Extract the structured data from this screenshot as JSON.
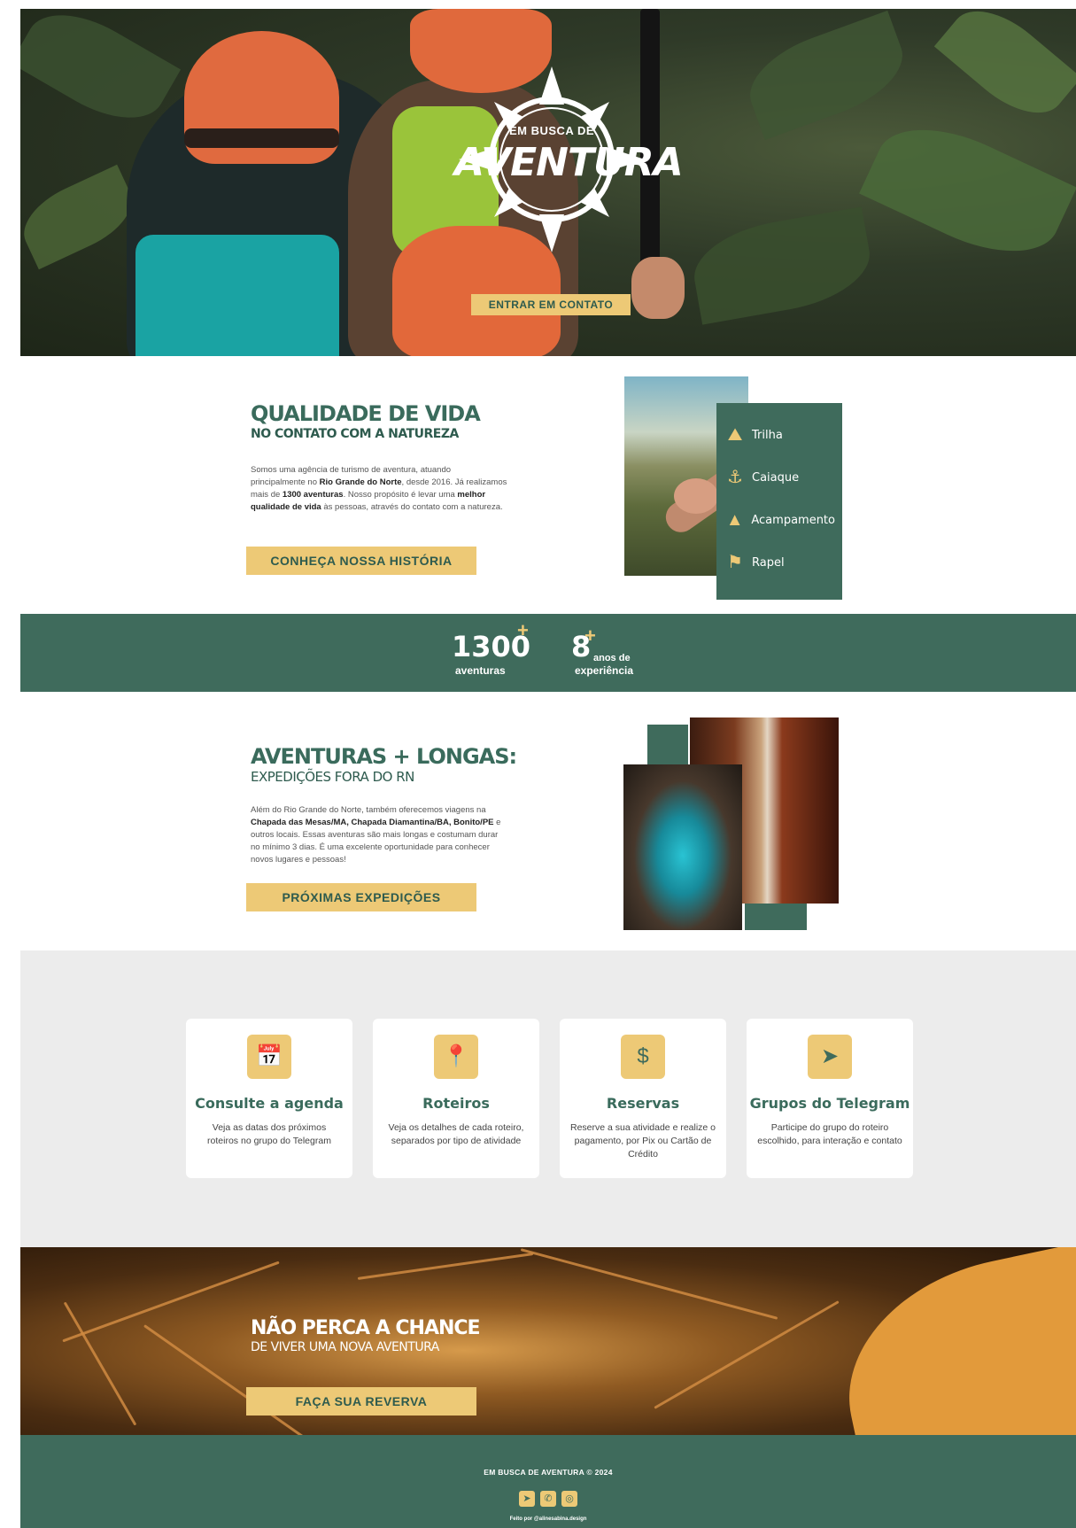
{
  "hero": {
    "logo_small": "EM BUSCA DE",
    "logo_big": "AVENTURA",
    "contact_button": "ENTRAR EM CONTATO"
  },
  "quality": {
    "title": "QUALIDADE DE VIDA",
    "subtitle": "NO CONTATO COM A NATUREZA",
    "paragraph": {
      "p1": "Somos uma agência de turismo de aventura, atuando principalmente no ",
      "b1": "Rio Grande do Norte",
      "p2": ", desde 2016. Já realizamos mais de ",
      "b2": "1300 aventuras",
      "p3": ". Nosso propósito é levar uma ",
      "b3": "melhor qualidade de vida",
      "p4": " às pessoas, através do contato com a natureza."
    },
    "button": "CONHEÇA NOSSA HISTÓRIA",
    "activities": [
      {
        "label": "Trilha",
        "icon": "hiker-icon"
      },
      {
        "label": "Caiaque",
        "icon": "kayak-icon"
      },
      {
        "label": "Acampamento",
        "icon": "tent-icon"
      },
      {
        "label": "Rapel",
        "icon": "rappel-icon"
      }
    ]
  },
  "stats": {
    "adventures_number": "1300",
    "adventures_plus": "+",
    "adventures_label": "aventuras",
    "years_number": "8",
    "years_plus": "+",
    "years_label_1": "anos de",
    "years_label_2": "experiência"
  },
  "expeditions": {
    "title": "AVENTURAS + LONGAS:",
    "subtitle": "EXPEDIÇÕES FORA DO RN",
    "paragraph": {
      "p1": "Além do Rio Grande do Norte, também oferecemos viagens na ",
      "b1": "Chapada das Mesas/MA, Chapada Diamantina/BA, Bonito/PE",
      "p2": " e outros locais. Essas aventuras são mais longas e costumam durar no mínimo 3 dias. É uma excelente oportunidade para conhecer novos lugares e pessoas!"
    },
    "button": "PRÓXIMAS EXPEDIÇÕES"
  },
  "services": [
    {
      "icon": "calendar-icon",
      "title": "Consulte a agenda",
      "text": "Veja as datas dos próximos roteiros no grupo do Telegram"
    },
    {
      "icon": "route-icon",
      "title": "Roteiros",
      "text": "Veja os detalhes de cada roteiro, separados por tipo de atividade"
    },
    {
      "icon": "payment-hand-icon",
      "title": "Reservas",
      "text": "Reserve a sua atividade e realize o pagamento, por Pix ou Cartão de Crédito"
    },
    {
      "icon": "telegram-icon",
      "title": "Grupos do Telegram",
      "text": "Participe do grupo do roteiro escolhido, para interação e contato"
    }
  ],
  "cta": {
    "title": "NÃO PERCA A CHANCE",
    "subtitle": "DE VIVER UMA NOVA AVENTURA",
    "button": "FAÇA SUA REVERVA"
  },
  "footer": {
    "copyright": "EM BUSCA DE AVENTURA © 2024",
    "icons": [
      "telegram-icon",
      "whatsapp-icon",
      "instagram-icon"
    ],
    "credit": "Feito por @alinesabina.design"
  },
  "colors": {
    "green": "#3f6b5c",
    "yellow": "#edc976",
    "light_gray": "#ececec"
  }
}
